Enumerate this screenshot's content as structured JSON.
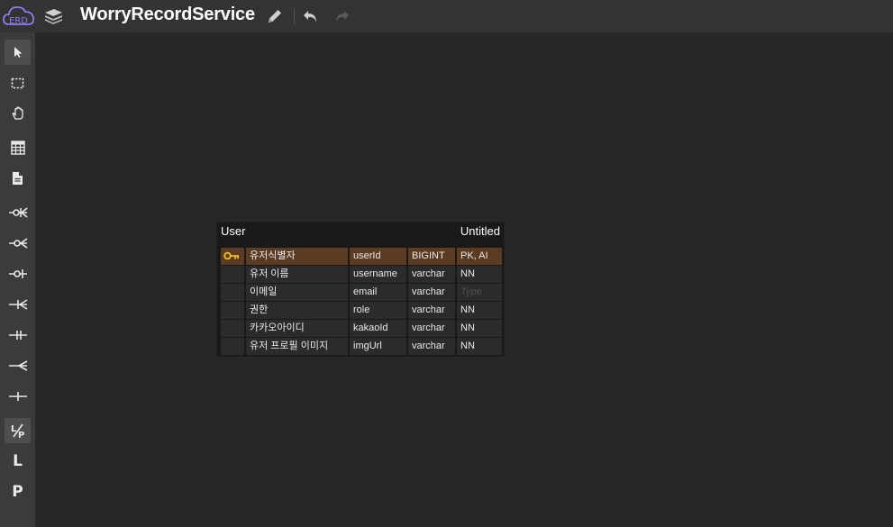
{
  "app": {
    "logo_text": "ERD",
    "title": "WorryRecordService"
  },
  "toolbar_icons": [
    "pencil-icon",
    "undo-icon",
    "redo-icon"
  ],
  "sidebar_tools": [
    {
      "name": "pointer-tool",
      "icon": "cursor-icon",
      "active": true
    },
    {
      "name": "select-tool",
      "icon": "marquee-icon"
    },
    {
      "name": "hand-tool",
      "icon": "hand-icon"
    },
    {
      "name": "table-tool",
      "icon": "table-icon"
    },
    {
      "name": "memo-tool",
      "icon": "memo-icon"
    },
    {
      "name": "relation-zero-one-n",
      "icon": "rel-zero-one-n-icon"
    },
    {
      "name": "relation-zero-n",
      "icon": "rel-zero-n-icon"
    },
    {
      "name": "relation-zero-one",
      "icon": "rel-zero-one-icon"
    },
    {
      "name": "relation-one-n",
      "icon": "rel-one-n-icon"
    },
    {
      "name": "relation-one-one",
      "icon": "rel-one-one-icon"
    },
    {
      "name": "relation-n",
      "icon": "rel-n-icon"
    },
    {
      "name": "relation-one",
      "icon": "rel-one-icon"
    },
    {
      "name": "identification-tool",
      "icon": "identification-icon",
      "active": true
    },
    {
      "name": "logical-tool",
      "label": "L"
    },
    {
      "name": "physical-tool",
      "label": "P"
    }
  ],
  "erd_table": {
    "name": "User",
    "comment": "Untitled",
    "columns": [
      {
        "pk": true,
        "logical": "유저식별자",
        "physical": "userId",
        "type": "BIGINT",
        "option": "PK, AI"
      },
      {
        "pk": false,
        "logical": "유저 이름",
        "physical": "username",
        "type": "varchar",
        "option": "NN"
      },
      {
        "pk": false,
        "logical": "이메일",
        "physical": "email",
        "type": "varchar",
        "option": "",
        "option_placeholder": "Type"
      },
      {
        "pk": false,
        "logical": "권한",
        "physical": "role",
        "type": "varchar",
        "option": "NN"
      },
      {
        "pk": false,
        "logical": "카카오아이디",
        "physical": "kakaoId",
        "type": "varchar",
        "option": "NN"
      },
      {
        "pk": false,
        "logical": "유저 프로필 이미지",
        "physical": "imgUrl",
        "type": "varchar",
        "option": "NN"
      }
    ]
  },
  "colors": {
    "background": "#272727",
    "topbar": "#333333",
    "sidebar": "#3b3b3b",
    "pk_row": "#5b3b22",
    "key_icon": "#f0c020",
    "logo": "#8c7cf0"
  }
}
